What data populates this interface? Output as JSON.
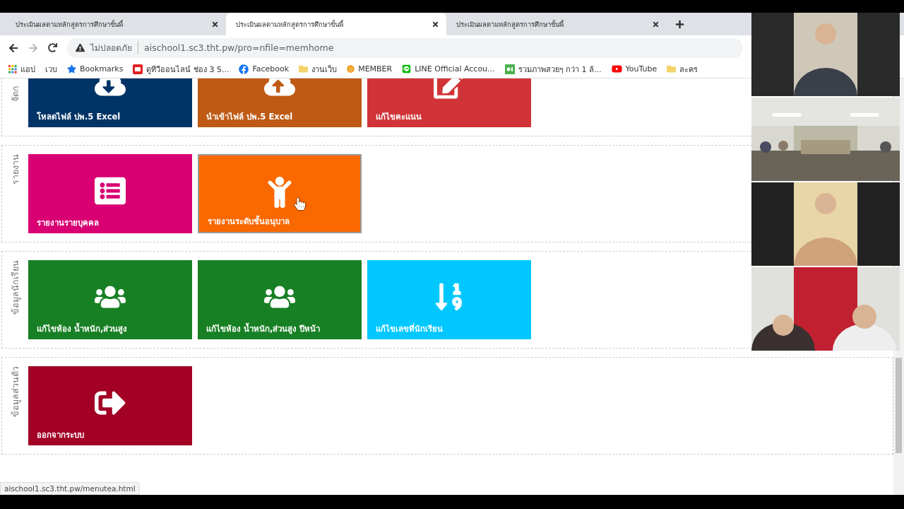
{
  "tabs": [
    {
      "title": "ประเมินผลตามหลักสูตรการศึกษาขั้นพื้",
      "selected": false
    },
    {
      "title": "ประเมินผลตามหลักสูตรการศึกษาขั้นพื้",
      "selected": true
    },
    {
      "title": "ประเมินผลตามหลักสูตรการศึกษาขั้นพื้",
      "selected": false
    }
  ],
  "address_bar": {
    "security": "ไม่ปลอดภัย",
    "url": "aischool1.sc3.tht.pw/pro=nfile=memhome"
  },
  "bookmarks": [
    {
      "kind": "apps",
      "label": "แอป"
    },
    {
      "kind": "none",
      "label": "เวบ"
    },
    {
      "kind": "star",
      "label": "Bookmarks"
    },
    {
      "kind": "tv",
      "label": "ดูทีวีออนไลน์ ช่อง 3 5..."
    },
    {
      "kind": "facebook",
      "label": "Facebook"
    },
    {
      "kind": "folder",
      "label": "งานเว็บ"
    },
    {
      "kind": "smiley",
      "label": "MEMBER"
    },
    {
      "kind": "line",
      "label": "LINE Official Accou..."
    },
    {
      "kind": "px",
      "label": "รวมภาพสวยๆ กว่า 1 ล้..."
    },
    {
      "kind": "youtube",
      "label": "YouTube"
    },
    {
      "kind": "folder",
      "label": "ละคร"
    }
  ],
  "sections": [
    {
      "label": "จัดก",
      "tiles": [
        {
          "label": "โหลดไฟล์ ปพ.5 Excel",
          "kind": "download",
          "color": "#003366",
          "highlighted": false
        },
        {
          "label": "นำเข้าไฟล์ ปพ.5 Excel",
          "kind": "upload",
          "color": "#bf5a15",
          "highlighted": false
        },
        {
          "label": "แก้ไขคะแนน",
          "kind": "edit",
          "color": "#d13438",
          "highlighted": false
        }
      ]
    },
    {
      "label": "รายงาน",
      "tiles": [
        {
          "label": "รายงานรายบุคคล",
          "kind": "list",
          "color": "#d80073",
          "highlighted": false
        },
        {
          "label": "รายงานระดับชั้นอนุบาล",
          "kind": "child",
          "color": "#fa6800",
          "highlighted": true
        }
      ]
    },
    {
      "label": "ข้อมูลนักเรียน",
      "tiles": [
        {
          "label": "แก้ไขห้อง น้ำหนัก,ส่วนสูง",
          "kind": "users",
          "color": "#188024",
          "highlighted": false
        },
        {
          "label": "แก้ไขห้อง น้ำหนัก,ส่วนสูง ปีหน้า",
          "kind": "users",
          "color": "#188024",
          "highlighted": false
        },
        {
          "label": "แก้ไขเลขที่นักเรียน",
          "kind": "sort",
          "color": "#00c8ff",
          "highlighted": false
        }
      ]
    },
    {
      "label": "ข้อมูลส่วนตัว",
      "tiles": [
        {
          "label": "ออกจากระบบ",
          "kind": "logout",
          "color": "#a20025",
          "highlighted": false
        }
      ]
    }
  ],
  "status_bar": "aischool1.sc3.tht.pw/menutea.html"
}
